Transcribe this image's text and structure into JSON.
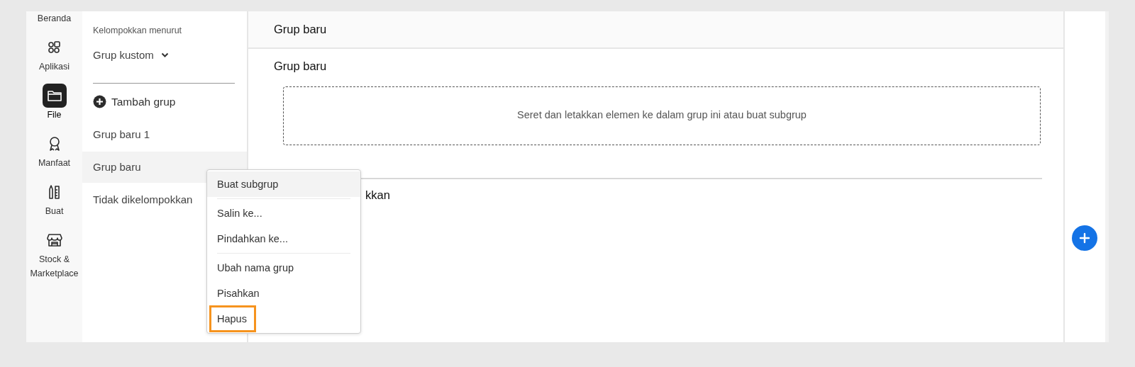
{
  "rail": {
    "items": [
      {
        "label": "Beranda",
        "selected": false
      },
      {
        "label": "Aplikasi",
        "selected": false
      },
      {
        "label": "File",
        "selected": true
      },
      {
        "label": "Manfaat",
        "selected": false
      },
      {
        "label": "Buat",
        "selected": false
      },
      {
        "label": "Stock & Marketplace",
        "selected": false
      }
    ]
  },
  "panel": {
    "group_by_label": "Kelompokkan menurut",
    "group_by_value": "Grup kustom",
    "add_group": "Tambah grup",
    "groups": [
      {
        "label": "Grup baru 1",
        "selected": false
      },
      {
        "label": "Grup baru",
        "selected": true
      },
      {
        "label": "Tidak dikelompokkan",
        "selected": false
      }
    ]
  },
  "main": {
    "header": "Grup baru",
    "section_title": "Grup baru",
    "drop_zone": "Seret dan letakkan elemen ke dalam grup ini atau buat subgrup",
    "next_section_title": "kkan"
  },
  "context_menu": {
    "items": [
      {
        "kind": "item",
        "label": "Buat subgrup",
        "hovered": true,
        "highlighted": false
      },
      {
        "kind": "divider"
      },
      {
        "kind": "item",
        "label": "Salin ke...",
        "hovered": false,
        "highlighted": false
      },
      {
        "kind": "item",
        "label": "Pindahkan ke...",
        "hovered": false,
        "highlighted": false
      },
      {
        "kind": "divider"
      },
      {
        "kind": "item",
        "label": "Ubah nama grup",
        "hovered": false,
        "highlighted": false
      },
      {
        "kind": "item",
        "label": "Pisahkan",
        "hovered": false,
        "highlighted": false
      },
      {
        "kind": "item",
        "label": "Hapus",
        "hovered": false,
        "highlighted": true
      }
    ]
  }
}
